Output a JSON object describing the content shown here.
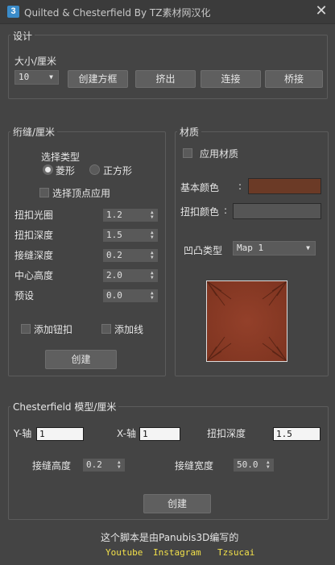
{
  "window": {
    "app_icon": "3",
    "title": "Quilted & Chesterfield By TZ素材网汉化",
    "close_icon": "close-icon"
  },
  "design": {
    "title": "设计",
    "size_label": "大小/厘米",
    "size_value": "10",
    "buttons": {
      "create_frame": "创建方框",
      "extrude": "挤出",
      "connect": "连接",
      "bridge": "桥接"
    }
  },
  "seam": {
    "title": "绗缝/厘米",
    "select_type": "选择类型",
    "diamond": "菱形",
    "square": "正方形",
    "select_vertex": "选择顶点应用",
    "params": [
      {
        "label": "扭扣光圈",
        "value": "1.2"
      },
      {
        "label": "扭扣深度",
        "value": "1.5"
      },
      {
        "label": "接缝深度",
        "value": "0.2"
      },
      {
        "label": "中心高度",
        "value": "2.0"
      },
      {
        "label": "预设",
        "value": "0.0"
      }
    ],
    "add_button": "添加钮扣",
    "add_line": "添加线",
    "create": "创建"
  },
  "material": {
    "title": "材质",
    "apply": "应用材质",
    "base_color_label": "基本颜色",
    "base_color_sep": ":",
    "base_color": "#6b3a26",
    "button_color_label": "扭扣颜色",
    "button_color_sep": ":",
    "button_color": "#555555",
    "bump_label": "凹凸类型",
    "bump_value": "Map 1",
    "preview_color": "#8c3a22"
  },
  "chesterfield": {
    "title": "Chesterfield 模型/厘米",
    "y_label": "Y-轴",
    "y_value": "1",
    "x_label": "X-轴",
    "x_value": "1",
    "depth_label": "扭扣深度",
    "depth_value": "1.5",
    "seam_height_label": "接缝高度",
    "seam_height_value": "0.2",
    "seam_width_label": "接缝宽度",
    "seam_width_value": "50.0",
    "create": "创建"
  },
  "footer": {
    "credit": "这个脚本是由Panubis3D编写的",
    "links": [
      "Youtube",
      "Instagram",
      "Tzsucai"
    ]
  }
}
